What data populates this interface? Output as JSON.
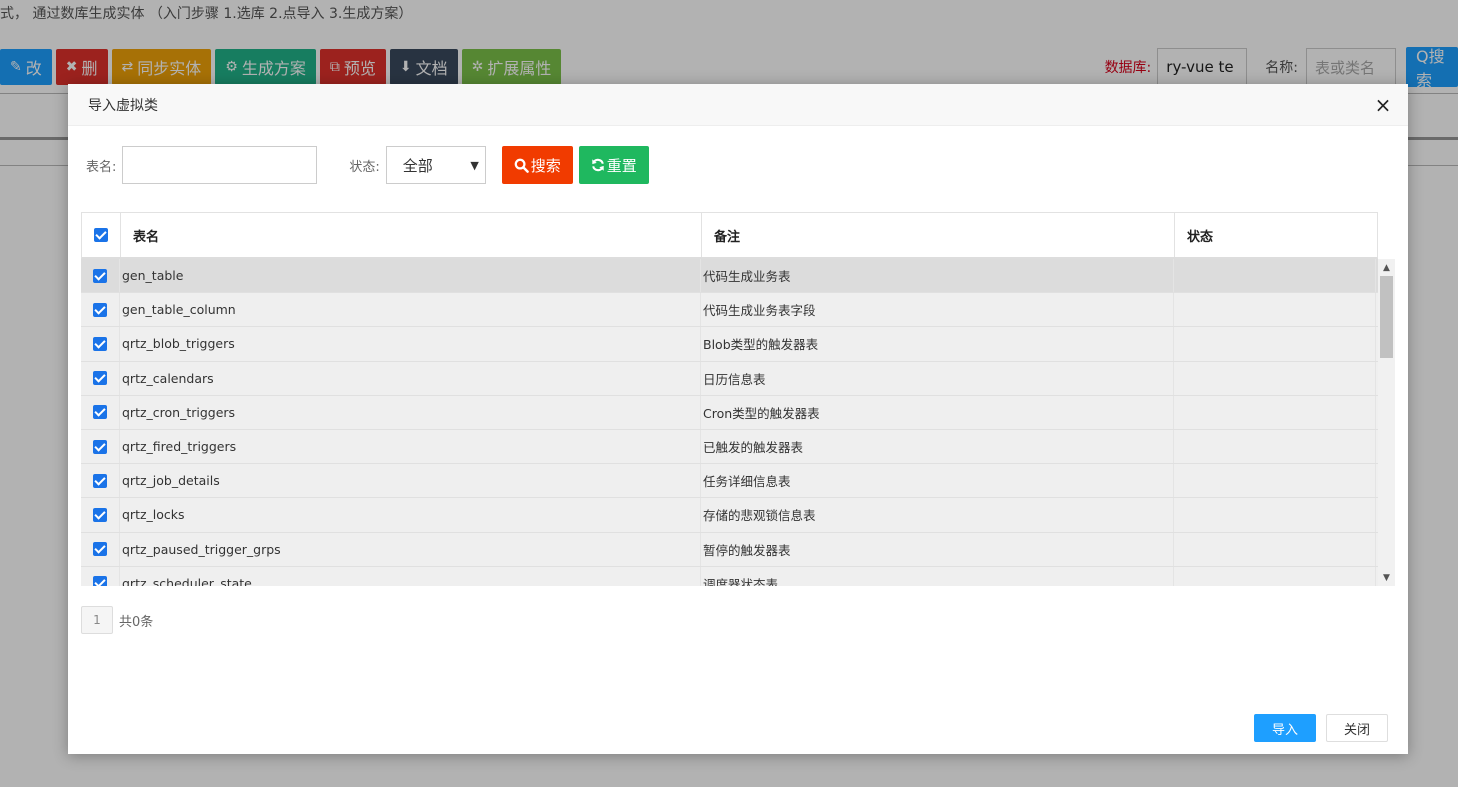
{
  "background": {
    "hint": "式， 通过数库生成实体 （入门步骤 1.选库 2.点导入 3.生成方案）",
    "toolbar": [
      {
        "name": "edit-button",
        "icon": "✎",
        "label": "改",
        "color": "#1e9fff"
      },
      {
        "name": "delete-button",
        "icon": "✖",
        "label": "删",
        "color": "#e0322c"
      },
      {
        "name": "sync-entity-button",
        "icon": "⇄",
        "label": "同步实体",
        "color": "#f0a30a"
      },
      {
        "name": "generate-plan-button",
        "icon": "⚙",
        "label": "生成方案",
        "color": "#21b38a"
      },
      {
        "name": "preview-button",
        "icon": "⧉",
        "label": "预览",
        "color": "#e0322c"
      },
      {
        "name": "doc-button",
        "icon": "⬇",
        "label": "文档",
        "color": "#3a4a5e"
      },
      {
        "name": "ext-attr-button",
        "icon": "✲",
        "label": "扩展属性",
        "color": "#7cc24a"
      }
    ],
    "db_label": "数据库:",
    "db_value": "ry-vue te",
    "name_label": "名称:",
    "name_placeholder": "表或类名",
    "search_label": "Q搜索"
  },
  "modal": {
    "title": "导入虚拟类",
    "close_icon": "×",
    "filter": {
      "table_name_label": "表名:",
      "table_name_value": "",
      "status_label": "状态:",
      "status_selected": "全部",
      "search_label": "搜索",
      "reset_label": "重置"
    },
    "table": {
      "columns": [
        "表名",
        "备注",
        "状态"
      ],
      "rows": [
        {
          "name": "gen_table",
          "note": "代码生成业务表",
          "status": ""
        },
        {
          "name": "gen_table_column",
          "note": "代码生成业务表字段",
          "status": ""
        },
        {
          "name": "qrtz_blob_triggers",
          "note": "Blob类型的触发器表",
          "status": ""
        },
        {
          "name": "qrtz_calendars",
          "note": "日历信息表",
          "status": ""
        },
        {
          "name": "qrtz_cron_triggers",
          "note": "Cron类型的触发器表",
          "status": ""
        },
        {
          "name": "qrtz_fired_triggers",
          "note": "已触发的触发器表",
          "status": ""
        },
        {
          "name": "qrtz_job_details",
          "note": "任务详细信息表",
          "status": ""
        },
        {
          "name": "qrtz_locks",
          "note": "存储的悲观锁信息表",
          "status": ""
        },
        {
          "name": "qrtz_paused_trigger_grps",
          "note": "暂停的触发器表",
          "status": ""
        },
        {
          "name": "qrtz_scheduler_state",
          "note": "调度器状态表",
          "status": ""
        }
      ]
    },
    "pager": {
      "page": "1",
      "total": "共0条"
    },
    "footer": {
      "import_label": "导入",
      "close_label": "关闭"
    }
  }
}
